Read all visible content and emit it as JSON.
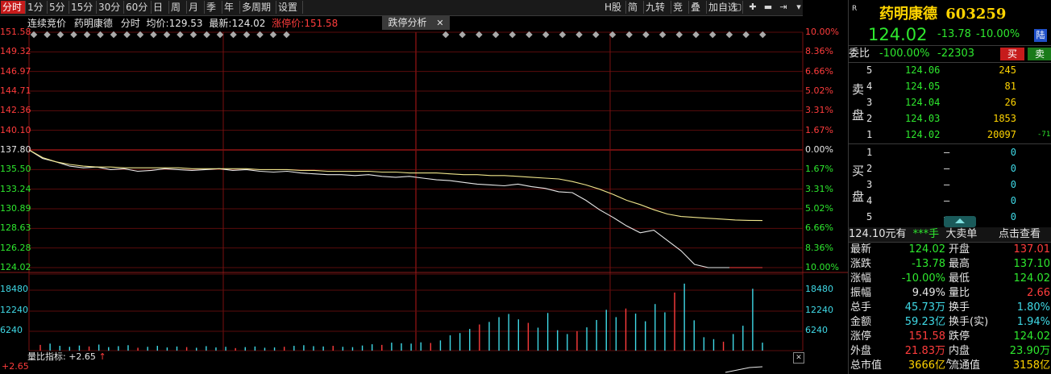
{
  "toolbar": {
    "periods": [
      "分时",
      "1分",
      "5分",
      "15分",
      "30分",
      "60分",
      "日",
      "周",
      "月",
      "季",
      "年",
      "多周期",
      "设置"
    ],
    "active": "分时",
    "right_tools": [
      "H股",
      "简",
      "九转",
      "竞",
      "叠",
      "加自选"
    ],
    "tool_icons": [
      "square-icon",
      "plus-icon",
      "minus-icon",
      "arrow-end-icon",
      "dropdown-icon"
    ]
  },
  "chart_header": {
    "auction": "连续竞价",
    "name": "药明康德",
    "mode": "分时",
    "avg_label": "均价:",
    "avg_value": "129.53",
    "latest_label": "最新:",
    "latest_value": "124.02",
    "limit_label": "涨停价:",
    "limit_value": "151.58",
    "analysis_tab": "跌停分析",
    "close_glyph": "✕"
  },
  "price_axis": {
    "left": [
      "151.58",
      "149.32",
      "146.97",
      "144.71",
      "142.36",
      "140.10",
      "137.80",
      "135.50",
      "133.24",
      "130.89",
      "128.63",
      "126.28",
      "124.02"
    ],
    "right": [
      "10.00%",
      "8.36%",
      "6.66%",
      "5.02%",
      "3.31%",
      "1.67%",
      "0.00%",
      "1.67%",
      "3.31%",
      "5.02%",
      "6.66%",
      "8.36%",
      "10.00%"
    ],
    "prev_close": 137.8,
    "max": 151.58,
    "min": 124.02
  },
  "volume_axis": {
    "left": [
      "18480",
      "12240",
      "6240"
    ],
    "right": [
      "18480",
      "12240",
      "6240"
    ]
  },
  "volume_indicator": {
    "label": "量比指标:",
    "value": "+2.65",
    "arrow": "↑",
    "left_value": "+2.65"
  },
  "chart_data": {
    "type": "line",
    "series": [
      {
        "values": [
          137.8,
          136.8,
          136.4,
          135.9,
          135.7,
          135.8,
          135.5,
          135.6,
          135.3,
          135.4,
          135.6,
          135.5,
          135.4,
          135.5,
          135.6,
          135.4,
          135.5,
          135.3,
          135.2,
          135.3,
          135.1,
          135.0,
          134.9,
          134.9,
          134.8,
          134.9,
          134.7,
          134.6,
          134.7,
          134.5,
          134.3,
          134.2,
          134.0,
          133.8,
          133.7,
          133.6,
          133.8,
          133.5,
          133.3,
          132.9,
          132.8,
          131.9,
          130.8,
          129.9,
          128.9,
          128.1,
          128.4,
          127.2,
          126.0,
          124.4,
          124.02,
          124.02,
          124.02,
          124.02,
          124.02
        ]
      },
      {
        "values": [
          137.8,
          136.9,
          136.4,
          136.1,
          135.9,
          135.8,
          135.8,
          135.7,
          135.7,
          135.7,
          135.7,
          135.7,
          135.6,
          135.6,
          135.6,
          135.6,
          135.6,
          135.5,
          135.5,
          135.5,
          135.4,
          135.4,
          135.3,
          135.3,
          135.3,
          135.3,
          135.2,
          135.2,
          135.1,
          135.1,
          135.1,
          135.0,
          134.9,
          134.9,
          134.8,
          134.8,
          134.7,
          134.6,
          134.5,
          134.4,
          134.1,
          133.7,
          133.2,
          132.6,
          131.9,
          131.4,
          130.8,
          130.3,
          130.0,
          129.9,
          129.8,
          129.7,
          129.6,
          129.55,
          129.53
        ]
      }
    ],
    "volume": [
      1800,
      2200,
      1500,
      1200,
      1600,
      1300,
      1900,
      1100,
      1400,
      1700,
      900,
      1200,
      1500,
      1000,
      1300,
      1100,
      900,
      1400,
      1000,
      1200,
      800,
      1100,
      1300,
      900,
      1000,
      1200,
      1500,
      1700,
      1400,
      1300,
      1500,
      1200,
      1100,
      1600,
      2000,
      1800,
      2500,
      2300,
      2200,
      2600,
      2400,
      3200,
      4800,
      5500,
      6800,
      8200,
      9000,
      10500,
      11500,
      9800,
      8700,
      7200,
      11800,
      6400,
      5200,
      6100,
      7300,
      9600,
      12800,
      10500,
      13200,
      11600,
      9200,
      14600,
      12000,
      18200,
      21000,
      9500,
      4200,
      3600,
      2800,
      5200,
      7800,
      19400,
      2500
    ]
  },
  "quote": {
    "tag": "R",
    "name": "药明康德",
    "code": "603259",
    "price": "124.02",
    "change": "-13.78",
    "pct": "-10.00%",
    "market_badge": "陆"
  },
  "weibi": {
    "label": "委比",
    "pct": "-100.00%",
    "diff": "-22303",
    "buy_btn": "买",
    "sell_btn": "卖"
  },
  "order_book": {
    "sell_label": "卖盘",
    "buy_label": "买盘",
    "sell": [
      {
        "level": "5",
        "price": "124.06",
        "vol": "245",
        "extra": ""
      },
      {
        "level": "4",
        "price": "124.05",
        "vol": "81",
        "extra": ""
      },
      {
        "level": "3",
        "price": "124.04",
        "vol": "26",
        "extra": ""
      },
      {
        "level": "2",
        "price": "124.03",
        "vol": "1853",
        "extra": ""
      },
      {
        "level": "1",
        "price": "124.02",
        "vol": "20097",
        "extra": "-71"
      }
    ],
    "buy": [
      {
        "level": "1",
        "price": "–",
        "vol": "0"
      },
      {
        "level": "2",
        "price": "–",
        "vol": "0"
      },
      {
        "level": "3",
        "price": "–",
        "vol": "0"
      },
      {
        "level": "4",
        "price": "–",
        "vol": "0"
      },
      {
        "level": "5",
        "price": "–",
        "vol": "0"
      }
    ]
  },
  "big_order_bar": {
    "price": "124.10",
    "unit": "元有",
    "hand": "***手",
    "link": "大卖单",
    "action": "点击查看"
  },
  "stats": [
    {
      "l1": "最新",
      "v1": "124.02",
      "l2": "开盘",
      "v2": "137.01",
      "c1": "g",
      "c2": "r"
    },
    {
      "l1": "涨跌",
      "v1": "-13.78",
      "l2": "最高",
      "v2": "137.10",
      "c1": "g",
      "c2": "g"
    },
    {
      "l1": "涨幅",
      "v1": "-10.00%",
      "l2": "最低",
      "v2": "124.02",
      "c1": "g",
      "c2": "g"
    },
    {
      "l1": "振幅",
      "v1": "9.49%",
      "l2": "量比",
      "v2": "2.66",
      "c1": "w",
      "c2": "r"
    },
    {
      "l1": "总手",
      "v1": "45.73万",
      "l2": "换手",
      "v2": "1.80%",
      "c1": "c",
      "c2": "c"
    },
    {
      "l1": "金额",
      "v1": "59.23亿",
      "l2": "换手(实)",
      "v2": "1.94%",
      "c1": "c",
      "c2": "c"
    },
    {
      "l1": "涨停",
      "v1": "151.58",
      "l2": "跌停",
      "v2": "124.02",
      "c1": "r",
      "c2": "g"
    },
    {
      "l1": "外盘",
      "v1": "21.83万",
      "l2": "内盘",
      "v2": "23.90万",
      "c1": "r",
      "c2": "g"
    },
    {
      "l1": "总市值",
      "v1": "3666亿",
      "l2": "流通值",
      "v2": "3158亿",
      "c1": "y",
      "c2": "y",
      "sup": "A"
    }
  ],
  "colors": {
    "price_line": "#e8e8e8",
    "avg_line": "#f0e68c",
    "grid": "#7a1010",
    "up": "#ff3c3c",
    "down": "#2ee82e",
    "volume": "#3fd9e6"
  }
}
